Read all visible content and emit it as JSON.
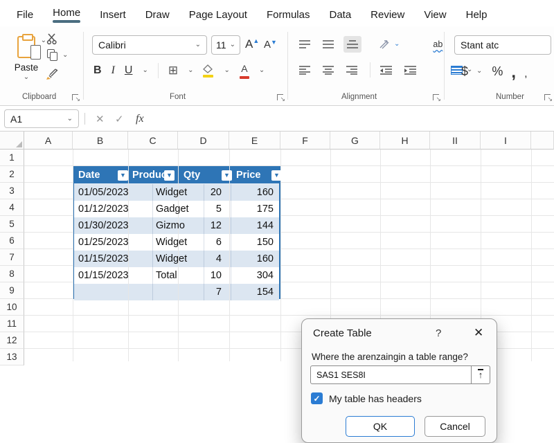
{
  "menubar": {
    "tabs": [
      {
        "label": "File",
        "active": false
      },
      {
        "label": "Home",
        "active": true
      },
      {
        "label": "Insert",
        "active": false
      },
      {
        "label": "Draw",
        "active": false
      },
      {
        "label": "Page Layout",
        "active": false
      },
      {
        "label": "Formulas",
        "active": false
      },
      {
        "label": "Data",
        "active": false
      },
      {
        "label": "Review",
        "active": false
      },
      {
        "label": "View",
        "active": false
      },
      {
        "label": "Help",
        "active": false
      }
    ]
  },
  "ribbon": {
    "clipboard": {
      "paste_label": "Paste",
      "group_label": "Clipboard"
    },
    "font": {
      "font_name": "Calibri",
      "font_size": "11",
      "grow_font": "A",
      "shrink_font": "A",
      "bold": "B",
      "italic": "I",
      "underline": "U",
      "borders_glyph": "⊞",
      "color_letter": "A",
      "group_label": "Font"
    },
    "alignment": {
      "wrap_text_label": "ab",
      "group_label": "Alignment"
    },
    "number": {
      "format_value": "Stant atc",
      "currency": "$",
      "percent": "%",
      "comma_large": ",",
      "comma_small": ",",
      "group_label": "Number"
    }
  },
  "formula_bar": {
    "name_box": "A1",
    "cancel_glyph": "✕",
    "enter_glyph": "✓",
    "fx_label": "fx",
    "formula_value": ""
  },
  "grid": {
    "columns": [
      "A",
      "B",
      "C",
      "D",
      "E",
      "F",
      "G",
      "H",
      "II",
      "I"
    ],
    "rows": [
      "1",
      "2",
      "3",
      "4",
      "5",
      "6",
      "7",
      "8",
      "9",
      "10",
      "11",
      "12",
      "13"
    ]
  },
  "table": {
    "headers": [
      "Date",
      "Produc",
      "Qty",
      "Price"
    ],
    "rows": [
      [
        "01/05/2023",
        "Widget",
        "20",
        "160"
      ],
      [
        "01/12/2023",
        "Gadget",
        "5",
        "175"
      ],
      [
        "01/30/2023",
        "Gizmo",
        "12",
        "144"
      ],
      [
        "01/25/2023",
        "Widget",
        "6",
        "150"
      ],
      [
        "01/15/2023",
        "Widget",
        "4",
        "160"
      ],
      [
        "01/15/2023",
        "Total",
        "10",
        "304"
      ],
      [
        "",
        "",
        "7",
        "154"
      ]
    ]
  },
  "dialog": {
    "title": "Create Table",
    "help_glyph": "?",
    "close_glyph": "✕",
    "prompt": "Where the arenzaingin a table range?",
    "range_value": "SAS1 SES8I",
    "checkbox_label": "My table has headers",
    "checkbox_checked": true,
    "ok_label": "QK",
    "cancel_label": "Cancel"
  },
  "glyphs": {
    "chevron": "⌄",
    "filter_arrow": "▼",
    "up_arrow": "↑"
  },
  "colors": {
    "table_header": "#2E75B6",
    "table_band": "#DCE6F1",
    "accent_blue": "#2B7CD3",
    "tab_underline": "#4A6D80"
  }
}
